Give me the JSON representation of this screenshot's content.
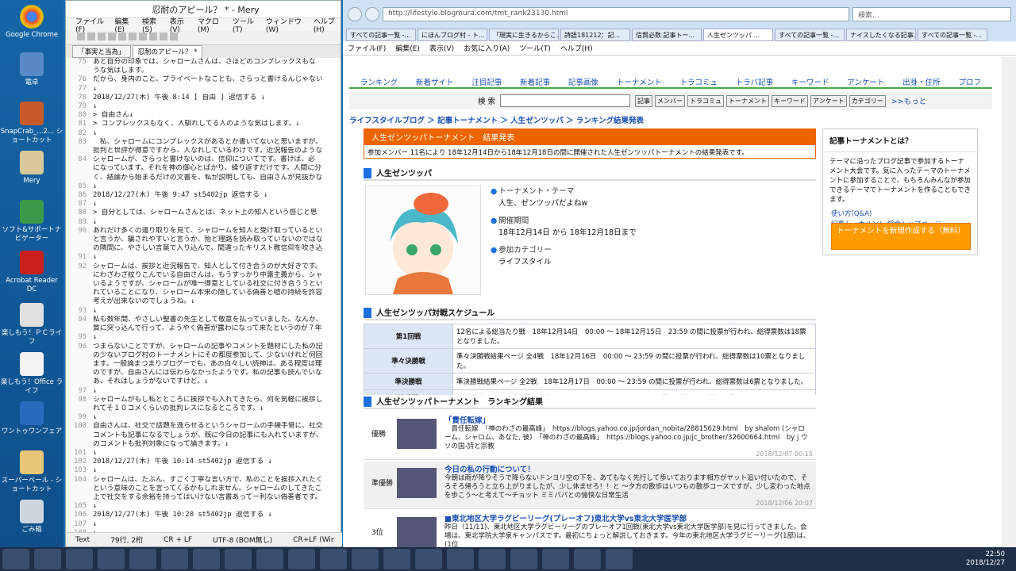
{
  "desktop_icons": [
    "Google Chrome",
    "電卓",
    "SnapCrab_...2... ショートカット",
    "Mery",
    "ソフト&サポートナビゲーター",
    "Acrobat Reader DC",
    "楽しもう！ＰＣライフ",
    "楽しもう！Office ライフ",
    "ワントゥワンフェア",
    "スーパーベール - ショートカット",
    "ごみ箱"
  ],
  "mery": {
    "title": "忍耐のアピール？ * - Mery",
    "menu": [
      "ファイル(F)",
      "編集(E)",
      "検索(S)",
      "表示(V)",
      "マクロ(M)",
      "ツール(T)",
      "ウィンドウ(W)",
      "ヘルプ(H)"
    ],
    "tabs": [
      "「事実と当為」",
      "忍耐のアピール？ *"
    ],
    "lines": [
      [
        "75",
        "あと自分の印象では、シャロームさんは、さほどのコンプレックスもな"
      ],
      [
        "",
        "うな気はします。"
      ],
      [
        "76",
        "だから、身内のこと、プライベートなことも、さらっと書けるんじゃない"
      ],
      [
        "77",
        "↓"
      ],
      [
        "78",
        "2018/12/27(木) 午後 8:14 [ 自由 ] 返信する ↓"
      ],
      [
        "79",
        "↓"
      ],
      [
        "80",
        "> 自由さん↓"
      ],
      [
        "81",
        "> コンプレックスもなく、人馴れしてる人のような気はします。↓"
      ],
      [
        "82",
        "↓"
      ],
      [
        "83",
        "　私、シャロームにコンプレックスがあるとか書いてないと思いますが。"
      ],
      [
        "",
        "批判と世評が得意ですから、人なれしているわけです。近況報告のような"
      ],
      [
        "84",
        "シャロームが、さらっと書けないのは、信仰についてです。書けば、必"
      ],
      [
        "",
        "になっています。それを神の御心とばかり、繰り返すだけです。人間に分"
      ],
      [
        "",
        "く、結論から始まるだけの文書を、私が説明しても、自由さんが見抜かな"
      ],
      [
        "85",
        "↓"
      ],
      [
        "86",
        "2018/12/27(木) 午後 9:47 st5402jp 返信する ↓"
      ],
      [
        "87",
        "↓"
      ],
      [
        "88",
        "> 自分としては、シャロームさんとは、ネット上の知人という感じと思"
      ],
      [
        "89",
        "↓"
      ],
      [
        "90",
        "あれだけ多くの遣り取りを見て、シャロームを知人と受け取っているとい"
      ],
      [
        "",
        "と言うか、騙されやすいと言うか、殆ど理路を読み取っていないのではな"
      ],
      [
        "",
        "の隣間に、やさしい言葉で入り込んで、間違ったキリスト教信仰を吹き込"
      ],
      [
        "91",
        "↓"
      ],
      [
        "92",
        "シャロームは、挨拶と近況報告で、知人として付き合うのが大好きです。"
      ],
      [
        "",
        "にわざわざ紋りこんでいる自由さんは、もうすっかり中庸主義から、シャ"
      ],
      [
        "",
        "いるようですが、シャロームが唯一得意としている社交に付き合ううとい"
      ],
      [
        "",
        "れていることになり、シャローム本来の隠している偽善と嘘の持続を許容"
      ],
      [
        "",
        "考えが出来ないのでしょうね。↓"
      ],
      [
        "93",
        "↓"
      ],
      [
        "94",
        "私も数年間、やさしい聖書の先生として敬意を払っていました。なんか、"
      ],
      [
        "",
        "質に突っ込んで行って、ようやく偽善が露わになって来たというのが７年"
      ],
      [
        "95",
        "↓"
      ],
      [
        "96",
        "つまらないことですが、シャロームの記事やコメントを題材にした私の記"
      ],
      [
        "",
        "の少ないブログ村のトーナメントにその都度参加して、少ないけれど何回"
      ],
      [
        "",
        "ます。一般論まつまりブログーでも、あの白々しい読神は、ある程度は理"
      ],
      [
        "",
        "のですが、自由さんには伝わらなかったようです。私の記事も読んでいな"
      ],
      [
        "",
        "あ、それはしょうがないですけど。↓"
      ],
      [
        "97",
        "↓"
      ],
      [
        "98",
        "シャロームがもし私とところに挨拶でも入れてきたら、何を気軽に挨拶し"
      ],
      [
        "",
        "れてそ１０コメくらいの批判レスになるところです。↓"
      ],
      [
        "99",
        "↓"
      ],
      [
        "100",
        "自由さんは、社交で話題を逸らせるというシャロームの手練手管に、社交"
      ],
      [
        "",
        "コメントも記事になるでしょうが、既に今日の記事にも入れていますが、"
      ],
      [
        "",
        "のコメントも批判対象になって論きます。↓"
      ],
      [
        "101",
        "↓"
      ],
      [
        "102",
        "2018/12/27(木) 午後 10:14 st5402jp 返信する ↓"
      ],
      [
        "103",
        "↓"
      ],
      [
        "104",
        "シャロームは、たぶん、すごく丁寧な言い方で、私のことを挨拶入れたく"
      ],
      [
        "",
        "という意味のことを言ってくるかもしれません。シャロームのしてきたこ"
      ],
      [
        "",
        "上で社交をする余裕を持ってはいけない言書あって一利ない偽善者です。"
      ],
      [
        "105",
        "↓"
      ],
      [
        "106",
        "2018/12/27(木) 午後 10:20 st5402jp 返信する ↓"
      ],
      [
        "107",
        "↓"
      ],
      [
        "108",
        "↓"
      ],
      [
        "109",
        "↓"
      ]
    ],
    "status": [
      "Text",
      "79行, 2桁",
      "CR + LF",
      "UTF-8 (BOM無し)",
      "CR+LF (Wir"
    ]
  },
  "browser": {
    "url": "http://lifestyle.blogmura.com/tmt_rank23130.html",
    "search_placeholder": "検索...",
    "tabs": [
      "すべての記事一覧 -...",
      "にほんブログ村 - ト...",
      "「現実に生きるからこ...",
      "詩語181212：記...",
      "信賢必数 記事トー...",
      "人生ゼンツッパ ...",
      "すべての記事一覧 -...",
      "ナイスしたくなる記事...",
      "すべての記事一覧 -..."
    ],
    "menu": [
      "ファイル(F)",
      "編集(E)",
      "表示(V)",
      "お気に入り(A)",
      "ツール(T)",
      "ヘルプ(H)"
    ],
    "nav": [
      "ランキング",
      "新着サイト",
      "注目記事",
      "新着記事",
      "記事画像",
      "トーナメント",
      "トラコミュ",
      "トラバ記事",
      "キーワード",
      "アンケート",
      "出身・住所",
      "プロフ"
    ],
    "search_label": "検 索",
    "search_buttons": [
      "記事",
      "メンバー",
      "トラコミュ",
      "トーナメント",
      "キーワード",
      "アンケート",
      "カテゴリー"
    ],
    "more": ">>もっと",
    "breadcrumb": "ライフスタイルブログ ＞ 記事トーナメント ＞ 人生ゼンツッパ ＞ ランキング結果発表",
    "result_title": "人生ゼンツッパトーナメント　結果発表",
    "result_sub": "参加メンバー 11名により 18年12月14日から18年12月18日の間に開催された人生ゼンツッパトーナメントの結果発表です。",
    "tourney_name": "人生ゼンツッパ",
    "info": [
      {
        "h": "トーナメント・テーマ",
        "v": "人生、ゼンツッパだよねw"
      },
      {
        "h": "開催期間",
        "v": "18年12月14日 から 18年12月18日まで"
      },
      {
        "h": "参加カテゴリー",
        "v": "ライフスタイル"
      }
    ],
    "schedule_title": "人生ゼンツッパ対戦スケジュール",
    "schedule": [
      {
        "k": "第1回戦",
        "v": "12名による総当たり戦　18年12月14日　00:00 ～ 18年12月15日　23:59 の間に投票が行われ、総得票数は18票となりました。"
      },
      {
        "k": "準々決勝戦",
        "v": "準々決勝戦結果ページ 全4戦　18年12月16日　00:00 ～ 23:59 の間に投票が行われ、総得票数は10票となりました。"
      },
      {
        "k": "準決勝戦",
        "v": "準決勝戦結果ページ 全2戦　18年12月17日　00:00 ～ 23:59 の間に投票が行われ、総得票数は6票となりました。"
      },
      {
        "k": "決勝戦",
        "v": "決勝戦結果ページ 全1戦　18年12月18日　00:00 ～ 23:59 の間に投票が行われ、総得票数は3票となりました。"
      }
    ],
    "ranking_title": "人生ゼンツッパトーナメント　ランキング結果",
    "ranking": [
      {
        "pos": "優勝",
        "title": "「責任転嫁」",
        "body": "　責任転嫁　「神のわざの最高峰」　https://blogs.yahoo.co.jp/jordan_nobita/28815629.html　by shalom (シャローム、シャロム、あなた, 彼)　「神のわざの最高峰」　https://blogs.yahoo.co.jp/jc_brother/32600664.html　by j ウソの国-詩と宗教",
        "date": "2018/12/07 00:15"
      },
      {
        "pos": "準優勝",
        "title": "今日の私の行動について！",
        "body": "今朝は雨が降りそうで降らないドンヨリ空の下を、あてもなく先行して歩いております相方がヤット追い付いたので、そろそろ帰ろうと立ち上がりましたが、少し休ませろ！！と ～夕方の散歩はいつもの散歩コースですが、少し変わった地点を歩こう～と考えて～チョット ミミパパとの愉快な日常生活",
        "date": "2018/12/06 20:07"
      },
      {
        "pos": "3位",
        "title": "■東北地区大学ラグビーリーグ(プレーオフ)東北大学vs東北大学医学部",
        "body": "昨日（11/11)、東北地区大学ラグビーリーグのプレーオフ1回戦(東北大学vs東北大学医学部)を見に行ってきました。会場は、東北学院大学泉キャンパスです。最初にちょっと解説しておきます。今年の東北地区大学ラグビーリーグ(1部)は、(1位",
        "date": ""
      }
    ],
    "side": {
      "title": "記事トーナメントとは？",
      "desc": "テーマに沿ったブログ記事で参加するトーナメント大会です。気に入ったテーマのトーナメントに参加することで、もちろんみんなが参加できるテーマでトーナメントを作ることもできます。",
      "links": [
        "使い方(Q&A)",
        "記事トーナメント 総合トップページ"
      ],
      "button": "トーナメントを新規作成する（無料）"
    }
  },
  "clock": {
    "time": "22:50",
    "date": "2018/12/27"
  }
}
